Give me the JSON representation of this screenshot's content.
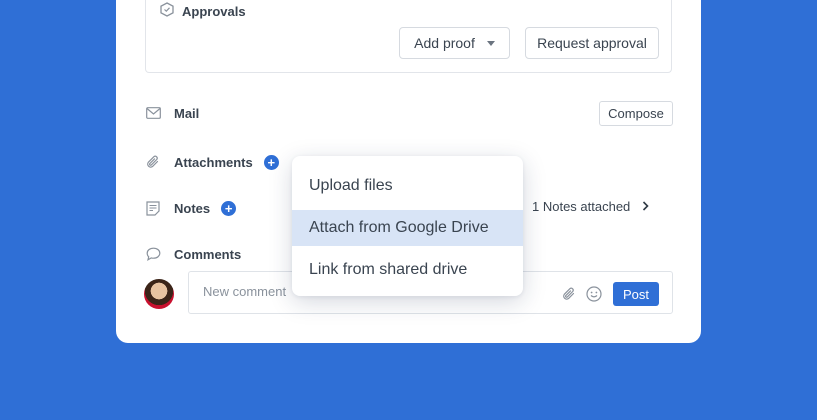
{
  "approvals": {
    "title": "Approvals",
    "add_proof_label": "Add proof",
    "request_approval_label": "Request approval"
  },
  "mail": {
    "label": "Mail",
    "compose_label": "Compose"
  },
  "attachments": {
    "label": "Attachments"
  },
  "notes": {
    "label": "Notes",
    "attached_text": "1 Notes attached"
  },
  "comments": {
    "label": "Comments",
    "placeholder": "New comment",
    "post_label": "Post"
  },
  "attach_menu": {
    "items": [
      {
        "label": "Upload files"
      },
      {
        "label": "Attach from Google Drive"
      },
      {
        "label": "Link from shared drive"
      }
    ],
    "highlighted_index": 1
  },
  "colors": {
    "background": "#2f6fd6",
    "accent": "#2f6fd6",
    "menu_highlight": "#d8e4f6"
  },
  "icons": [
    "hexagon-icon",
    "caret-down-icon",
    "mail-icon",
    "paperclip-icon",
    "plus-icon",
    "notes-icon",
    "chevron-right-icon",
    "comment-icon",
    "avatar",
    "emoji-icon"
  ]
}
